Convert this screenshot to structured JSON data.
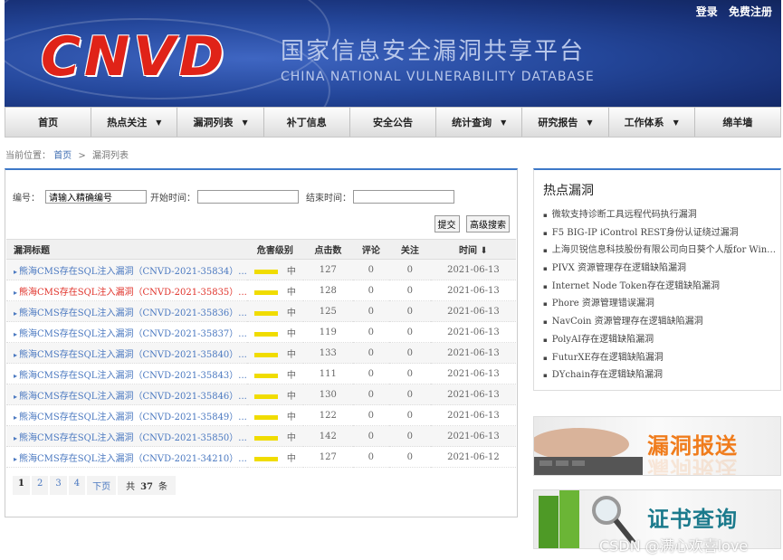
{
  "header": {
    "logo": "CNVD",
    "cn_title": "国家信息安全漏洞共享平台",
    "en_title": "CHINA NATIONAL VULNERABILITY DATABASE",
    "login": "登录",
    "register": "免费注册"
  },
  "nav": [
    {
      "label": "首页",
      "dropdown": false
    },
    {
      "label": "热点关注",
      "dropdown": true
    },
    {
      "label": "漏洞列表",
      "dropdown": true
    },
    {
      "label": "补丁信息",
      "dropdown": false
    },
    {
      "label": "安全公告",
      "dropdown": false
    },
    {
      "label": "统计查询",
      "dropdown": true
    },
    {
      "label": "研究报告",
      "dropdown": true
    },
    {
      "label": "工作体系",
      "dropdown": true
    },
    {
      "label": "绵羊墙",
      "dropdown": false
    }
  ],
  "breadcrumb": {
    "prefix": "当前位置：",
    "home": "首页",
    "sep": ">",
    "current": "漏洞列表"
  },
  "search": {
    "id_label": "编号：",
    "id_value": "请输入精确编号",
    "start_label": "开始时间：",
    "end_label": "结束时间：",
    "submit": "提交",
    "advanced": "高级搜索"
  },
  "table": {
    "headers": {
      "title": "漏洞标题",
      "level": "危害级别",
      "clicks": "点击数",
      "comments": "评论",
      "follows": "关注",
      "time": "时间 ⬇"
    },
    "rows": [
      {
        "title": "熊海CMS存在SQL注入漏洞（CNVD-2021-35834）...",
        "level": "中",
        "clicks": "127",
        "comments": "0",
        "follows": "0",
        "date": "2021-06-13"
      },
      {
        "title": "熊海CMS存在SQL注入漏洞（CNVD-2021-35835）...",
        "level": "中",
        "clicks": "128",
        "comments": "0",
        "follows": "0",
        "date": "2021-06-13"
      },
      {
        "title": "熊海CMS存在SQL注入漏洞（CNVD-2021-35836）...",
        "level": "中",
        "clicks": "125",
        "comments": "0",
        "follows": "0",
        "date": "2021-06-13"
      },
      {
        "title": "熊海CMS存在SQL注入漏洞（CNVD-2021-35837）...",
        "level": "中",
        "clicks": "119",
        "comments": "0",
        "follows": "0",
        "date": "2021-06-13"
      },
      {
        "title": "熊海CMS存在SQL注入漏洞（CNVD-2021-35840）...",
        "level": "中",
        "clicks": "133",
        "comments": "0",
        "follows": "0",
        "date": "2021-06-13"
      },
      {
        "title": "熊海CMS存在SQL注入漏洞（CNVD-2021-35843）...",
        "level": "中",
        "clicks": "111",
        "comments": "0",
        "follows": "0",
        "date": "2021-06-13"
      },
      {
        "title": "熊海CMS存在SQL注入漏洞（CNVD-2021-35846）...",
        "level": "中",
        "clicks": "130",
        "comments": "0",
        "follows": "0",
        "date": "2021-06-13"
      },
      {
        "title": "熊海CMS存在SQL注入漏洞（CNVD-2021-35849）...",
        "level": "中",
        "clicks": "122",
        "comments": "0",
        "follows": "0",
        "date": "2021-06-13"
      },
      {
        "title": "熊海CMS存在SQL注入漏洞（CNVD-2021-35850）...",
        "level": "中",
        "clicks": "142",
        "comments": "0",
        "follows": "0",
        "date": "2021-06-13"
      },
      {
        "title": "熊海CMS存在SQL注入漏洞（CNVD-2021-34210）...",
        "level": "中",
        "clicks": "127",
        "comments": "0",
        "follows": "0",
        "date": "2021-06-12"
      }
    ]
  },
  "pager": {
    "pages": [
      "1",
      "2",
      "3",
      "4"
    ],
    "next": "下页",
    "total_prefix": "共",
    "total": "37",
    "total_suffix": "条"
  },
  "hot": {
    "title": "热点漏洞",
    "items": [
      "微软支持诊断工具远程代码执行漏洞",
      "F5 BIG-IP iControl REST身份认证绕过漏洞",
      "上海贝锐信息科技股份有限公司向日葵个人版for Windows存在命令执行漏洞",
      "PIVX 资源管理存在逻辑缺陷漏洞",
      "Internet Node Token存在逻辑缺陷漏洞",
      "Phore 资源管理错误漏洞",
      "NavCoin 资源管理存在逻辑缺陷漏洞",
      "PolyAI存在逻辑缺陷漏洞",
      "FuturXE存在逻辑缺陷漏洞",
      "DYchain存在逻辑缺陷漏洞"
    ]
  },
  "promos": {
    "report": "漏洞报送",
    "cert": "证书查询"
  },
  "watermark": "CSDN @满心欢喜love",
  "colors": {
    "header_bg": "#24479b",
    "logo_red": "#e02318",
    "accent_blue": "#3d78c8",
    "link_blue": "#4a78c0",
    "highlight_red": "#e0322a",
    "level_bar": "#f0dc00"
  }
}
